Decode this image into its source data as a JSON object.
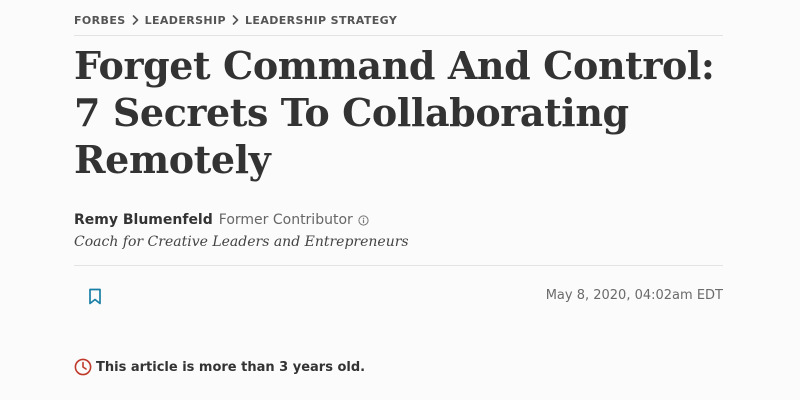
{
  "breadcrumb": {
    "items": [
      "FORBES",
      "LEADERSHIP",
      "LEADERSHIP STRATEGY"
    ],
    "separator_icon": "chevron-right-icon"
  },
  "article": {
    "headline": "Forget Command And Control: 7 Secrets To Collaborating Remotely",
    "author": {
      "name": "Remy Blumenfeld",
      "role": "Former Contributor",
      "role_icon": "info-circle-icon",
      "bio": "Coach for Creative Leaders and Entrepreneurs"
    },
    "bookmark_icon": "bookmark-icon",
    "published": "May 8, 2020, 04:02am EDT",
    "age_notice": {
      "icon": "clock-icon",
      "text": "This article is more than 3 years old."
    }
  },
  "colors": {
    "background": "#fbfbfb",
    "text": "#333333",
    "accent_bookmark": "#1a7fa6",
    "alert_red": "#c0392b",
    "divider": "#e3e3e3"
  }
}
